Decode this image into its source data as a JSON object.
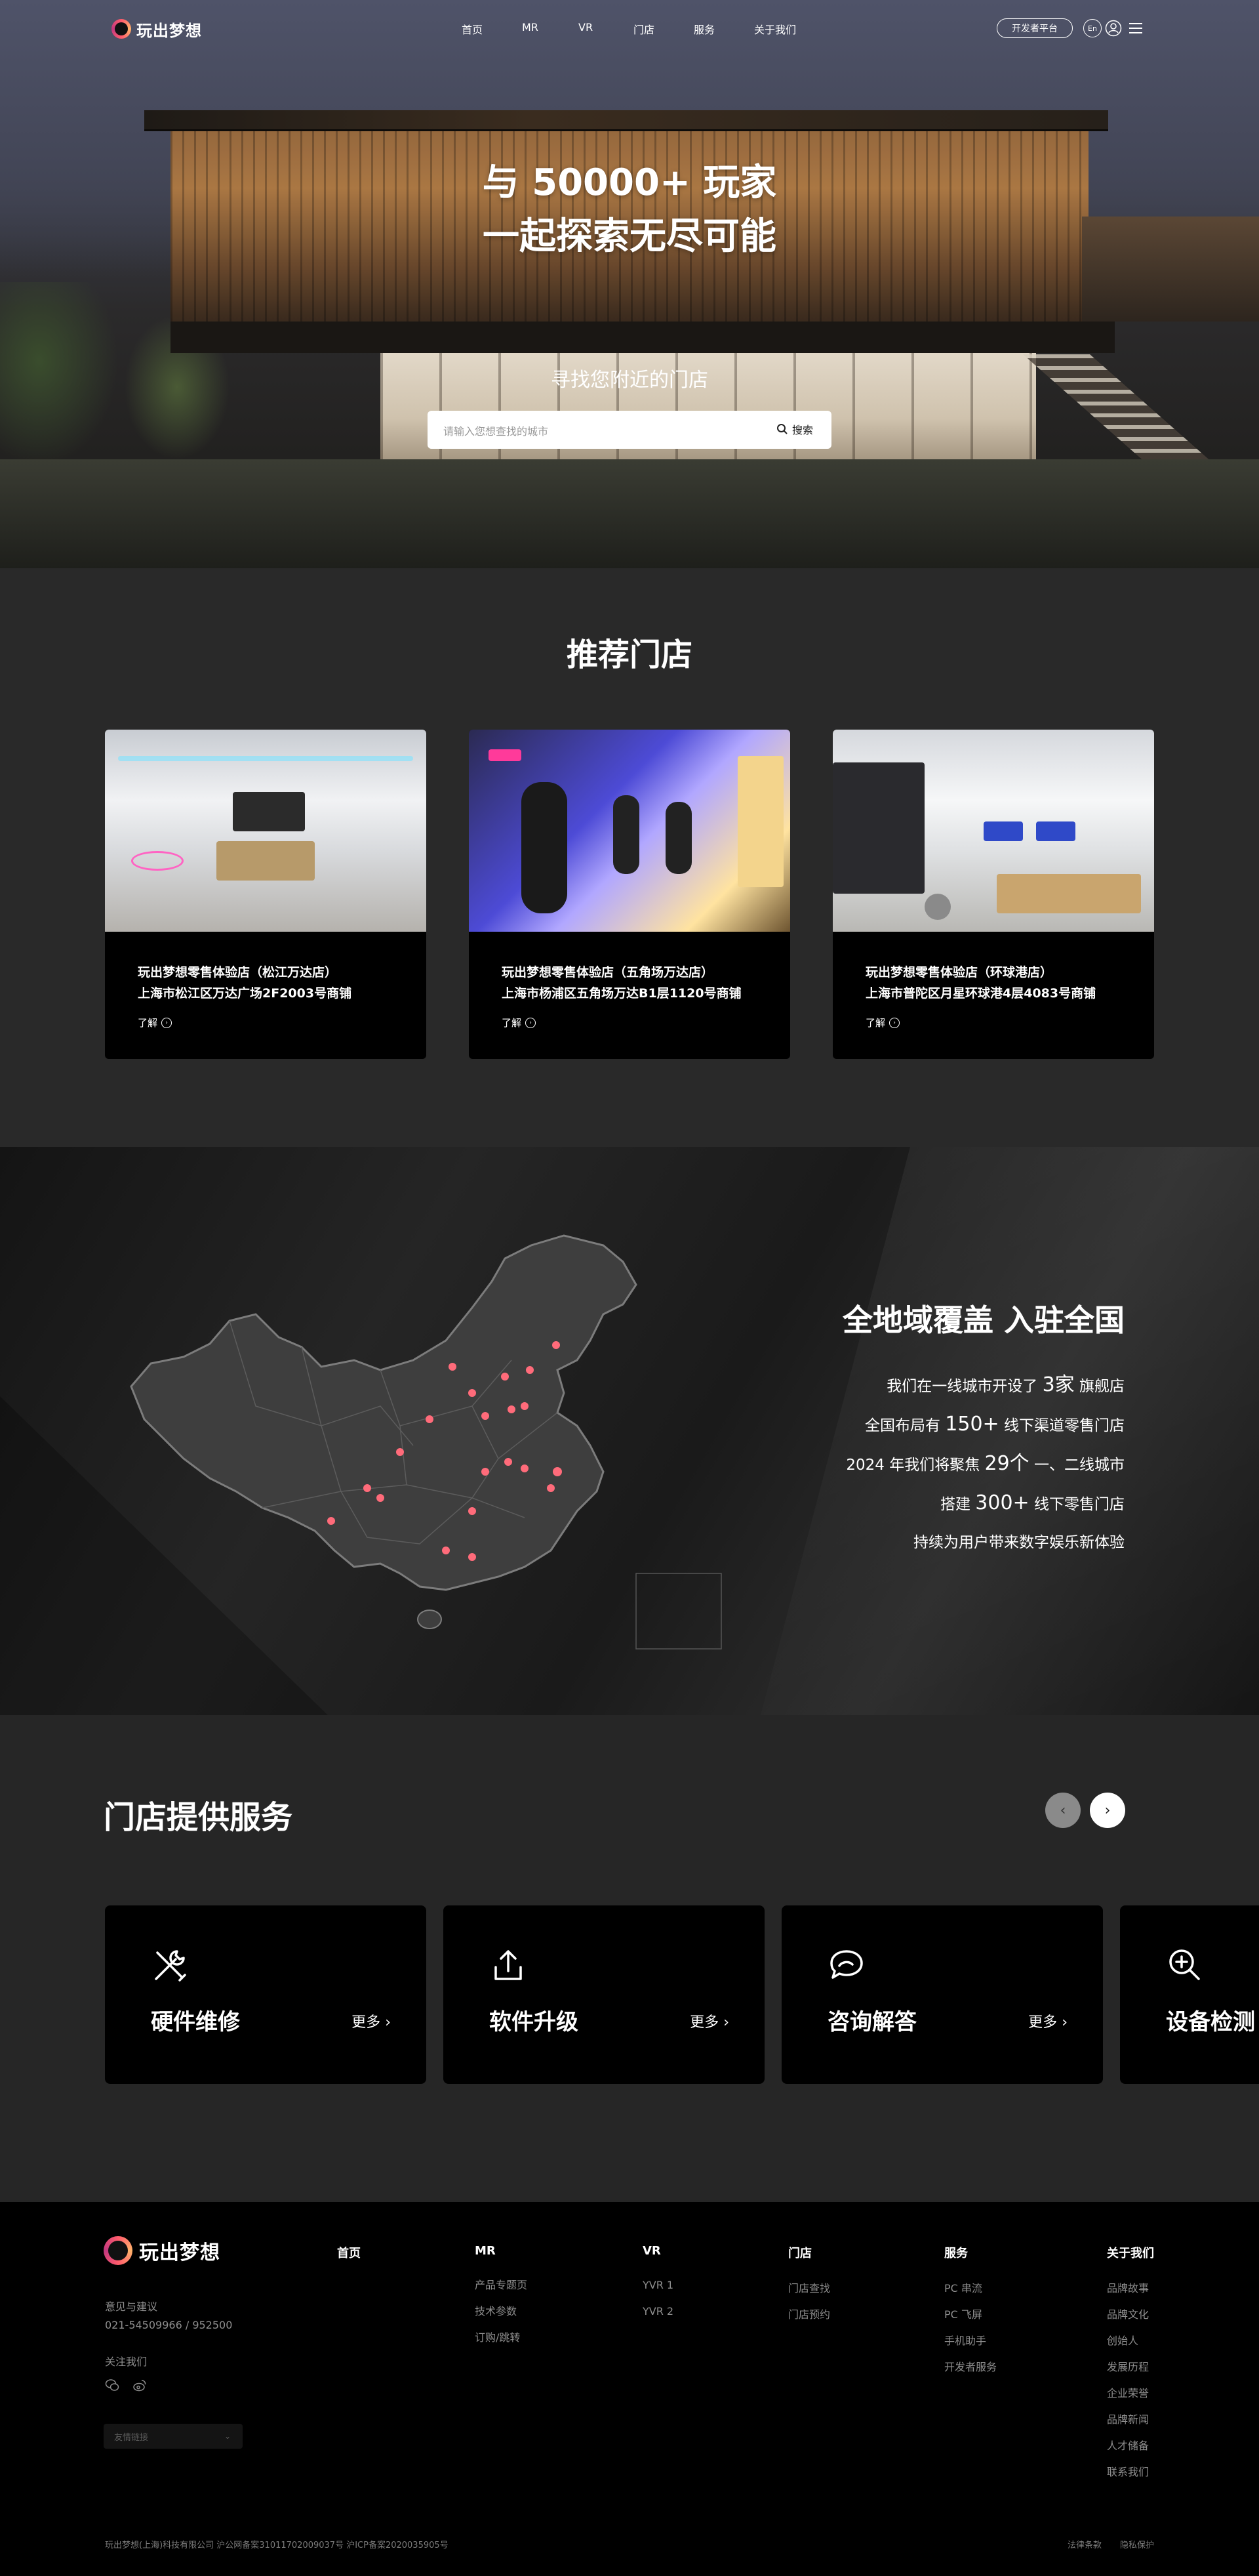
{
  "header": {
    "brand": "玩出梦想",
    "nav": [
      "首页",
      "MR",
      "VR",
      "门店",
      "服务",
      "关于我们"
    ],
    "dev_button": "开发者平台",
    "lang": "En"
  },
  "hero": {
    "title_line1": "与 50000+ 玩家",
    "title_line2": "一起探索无尽可能",
    "subtitle": "寻找您附近的门店",
    "search_placeholder": "请输入您想查找的城市",
    "search_button": "搜索"
  },
  "recommended": {
    "title": "推荐门店",
    "more_label": "了解",
    "stores": [
      {
        "name": "玩出梦想零售体验店（松江万达店）",
        "address": "上海市松江区万达广场2F2003号商铺"
      },
      {
        "name": "玩出梦想零售体验店（五角场万达店）",
        "address": "上海市杨浦区五角场万达B1层1120号商铺"
      },
      {
        "name": "玩出梦想零售体验店（环球港店）",
        "address": "上海市普陀区月星环球港4层4083号商铺"
      }
    ]
  },
  "coverage": {
    "title": "全地域覆盖 入驻全国",
    "stats": [
      {
        "pre": "我们在一线城市开设了 ",
        "big": "3家",
        "post": " 旗舰店"
      },
      {
        "pre": "全国布局有 ",
        "big": "150+",
        "post": " 线下渠道零售门店"
      },
      {
        "pre": "2024 年我们将聚焦 ",
        "big": "29个",
        "post": " 一、二线城市"
      },
      {
        "pre": "搭建 ",
        "big": "300+",
        "post": " 线下零售门店"
      },
      {
        "pre": "持续为用户带来数字娱乐新体验",
        "big": "",
        "post": ""
      }
    ],
    "marker_color": "#ff6b7a"
  },
  "services": {
    "title": "门店提供服务",
    "more_label": "更多",
    "items": [
      {
        "name": "硬件维修",
        "icon": "wrench-screwdriver-icon"
      },
      {
        "name": "软件升级",
        "icon": "upload-icon"
      },
      {
        "name": "咨询解答",
        "icon": "chat-bubble-icon"
      },
      {
        "name": "设备检测",
        "icon": "magnifier-plus-icon"
      }
    ]
  },
  "footer": {
    "brand": "玩出梦想",
    "feedback_label": "意见与建议",
    "phone": "021-54509966 / 952500",
    "follow_label": "关注我们",
    "friend_links": "友情链接",
    "columns": [
      {
        "title": "首页",
        "items": []
      },
      {
        "title": "MR",
        "items": [
          "产品专题页",
          "技术参数",
          "订购/跳转"
        ]
      },
      {
        "title": "VR",
        "items": [
          "YVR 1",
          "YVR 2"
        ]
      },
      {
        "title": "门店",
        "items": [
          "门店查找",
          "门店预约"
        ]
      },
      {
        "title": "服务",
        "items": [
          "PC 串流",
          "PC 飞屏",
          "手机助手",
          "开发者服务"
        ]
      },
      {
        "title": "关于我们",
        "items": [
          "品牌故事",
          "品牌文化",
          "创始人",
          "发展历程",
          "企业荣誉",
          "品牌新闻",
          "人才储备",
          "联系我们"
        ]
      }
    ],
    "copyright": "玩出梦想(上海)科技有限公司   沪公网备案31011702009037号   沪ICP备案2020035905号",
    "legal": [
      "法律条款",
      "隐私保护"
    ]
  }
}
